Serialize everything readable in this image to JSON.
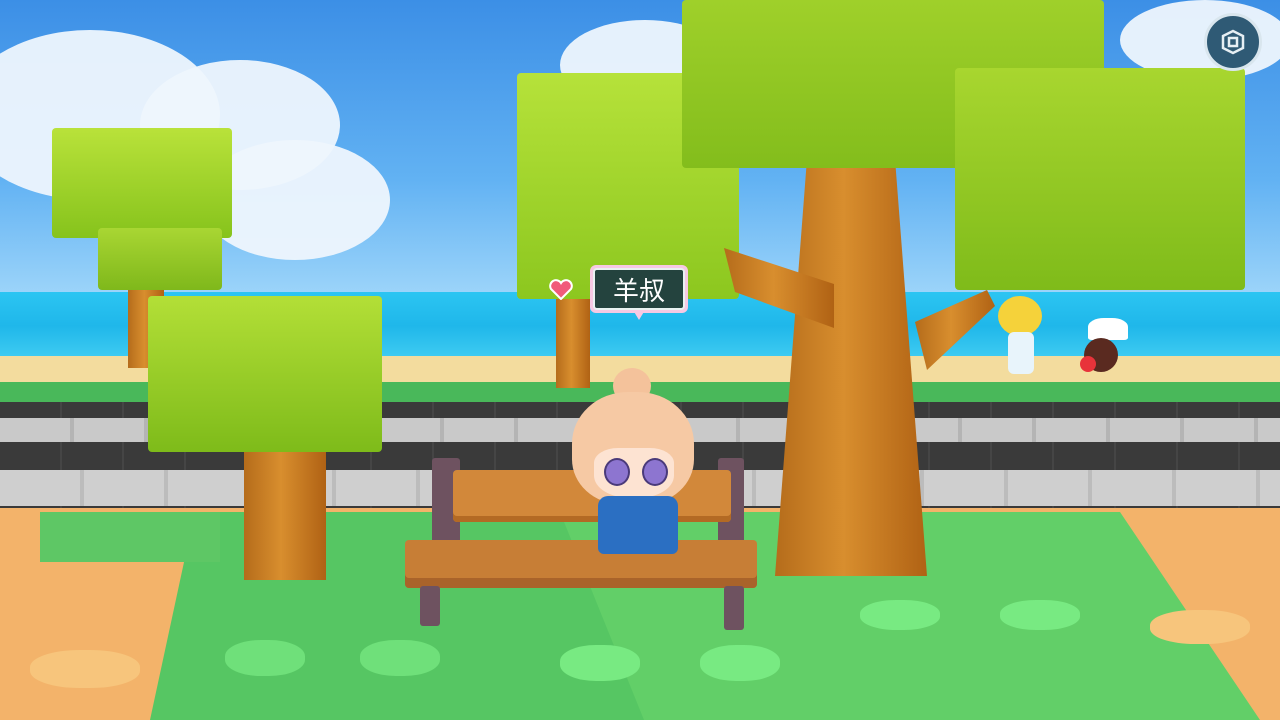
{
  "player": {
    "name_tag": "羊叔"
  },
  "hud": {
    "camera_button_icon": "camera-toggle-icon"
  },
  "scene": {
    "description_icons": [
      "heart-emote-icon"
    ],
    "colors": {
      "sky": "#4fa2ee",
      "sea": "#22bdee",
      "grass": "#5cc964",
      "sand": "#f3dc9e",
      "path": "#f3b36a"
    }
  }
}
